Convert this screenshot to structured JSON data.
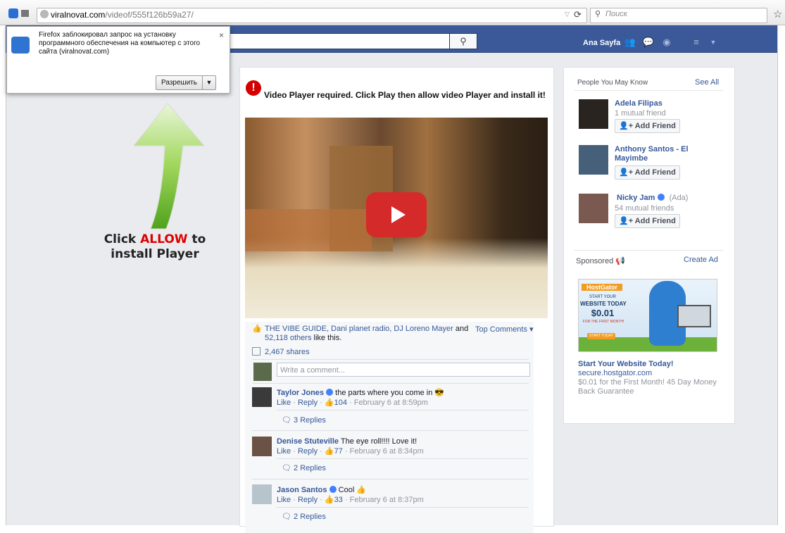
{
  "browser": {
    "url_host": "viralnovat.com",
    "url_path": "/videof/555f126b59a27/",
    "search_placeholder": "Поиск"
  },
  "popup": {
    "message": "Firefox заблокировал запрос на установку программного обеспечения на компьютер с этого сайта (viralnovat.com)",
    "allow_label": "Разрешить",
    "close": "×"
  },
  "instruction": {
    "line1_a": "Click ",
    "line1_b": "ALLOW",
    "line1_c": " to",
    "line2": "install Player"
  },
  "fb": {
    "home_label": "Ana Sayfa"
  },
  "post": {
    "warning": "Video Player required. Click Play then allow video Player and install it!",
    "likes_names": "THE VIBE GUIDE, Dani planet radio, DJ Loreno Mayer",
    "likes_and": " and ",
    "likes_others": "52,118 others",
    "likes_tail": " like this.",
    "top_comments": "Top Comments ▾",
    "shares": "2,467 shares",
    "comment_placeholder": "Write a comment..."
  },
  "comments": [
    {
      "name": "Taylor Jones",
      "text": " the parts where you come in 😎",
      "like": "Like",
      "reply": "Reply",
      "count": "104",
      "time": "February 6 at 8:59pm",
      "replies": "3 Replies"
    },
    {
      "name": "Denise Stuteville",
      "text": " The eye roll!!!! Love it!",
      "like": "Like",
      "reply": "Reply",
      "count": "77",
      "time": "February 6 at 8:34pm",
      "replies": "2 Replies"
    },
    {
      "name": "Jason Santos",
      "text": " Cool 👍",
      "like": "Like",
      "reply": "Reply",
      "count": "33",
      "time": "February 6 at 8:37pm",
      "replies": "2 Replies"
    }
  ],
  "sidebar": {
    "people_title": "People You May Know",
    "see_all": "See All",
    "add_friend": "Add Friend",
    "people": [
      {
        "name": "Adela Filipas",
        "sub": "1 mutual friend"
      },
      {
        "name": "Anthony Santos - El Mayimbe",
        "sub": ""
      },
      {
        "name": "Nicky Jam",
        "extra": "(Ada)",
        "sub": "54 mutual friends"
      }
    ],
    "sponsored": "Sponsored",
    "create_ad": "Create Ad",
    "ad": {
      "brand": "HostGator",
      "banner_line1": "START YOUR",
      "banner_line2": "WEBSITE TODAY",
      "banner_price": "$0.01",
      "banner_line3": "FOR THE FIRST MONTH!",
      "banner_cta": "START TODAY",
      "title": "Start Your Website Today!",
      "domain": "secure.hostgator.com",
      "desc": "$0.01 for the First Month! 45 Day Money Back Guarantee"
    }
  }
}
